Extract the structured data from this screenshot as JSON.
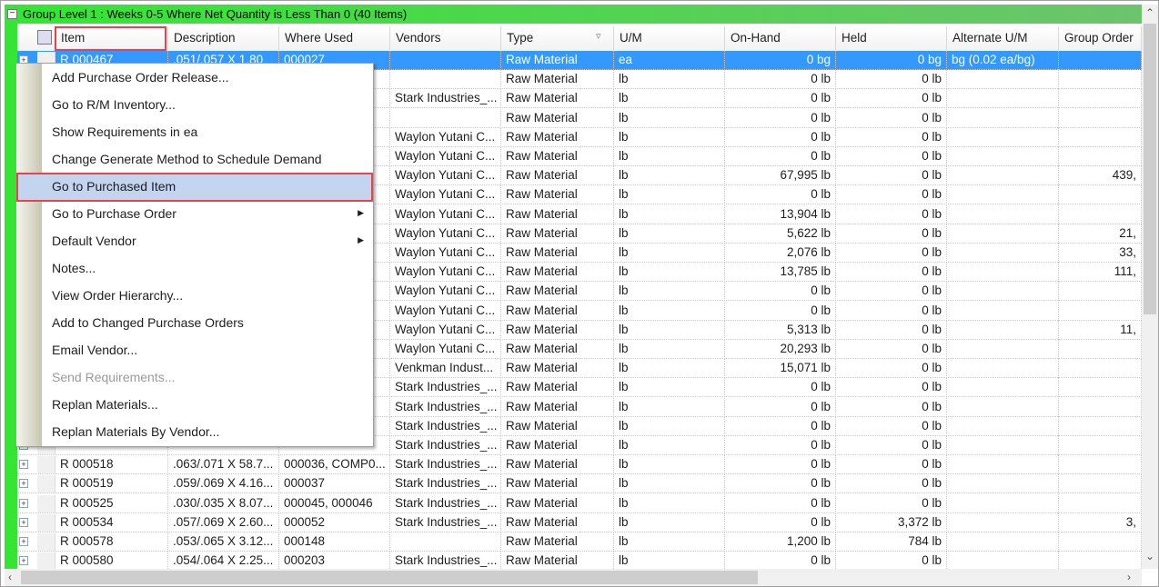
{
  "group": {
    "title": "Group Level 1 : Weeks 0-5 Where Net Quantity is Less Than 0 (40 Items)",
    "expand": "−"
  },
  "columns": [
    "Item",
    "Description",
    "Where Used",
    "Vendors",
    "Type",
    "U/M",
    "On-Hand",
    "Held",
    "Alternate U/M",
    "Group Order"
  ],
  "rows": [
    [
      "R 000467",
      ".051/.057 X 1.80",
      "000027",
      "",
      "Raw Material",
      "ea",
      "0 bg",
      "0 bg",
      "bg (0.02 ea/bg)",
      ""
    ],
    [
      "",
      "",
      "",
      "",
      "Raw Material",
      "lb",
      "0 lb",
      "0 lb",
      "",
      ""
    ],
    [
      "",
      "",
      "",
      "Stark Industries_...",
      "Raw Material",
      "lb",
      "0 lb",
      "0 lb",
      "",
      ""
    ],
    [
      "",
      "",
      "",
      "",
      "Raw Material",
      "lb",
      "0 lb",
      "0 lb",
      "",
      ""
    ],
    [
      "",
      "",
      "",
      "Waylon Yutani C...",
      "Raw Material",
      "lb",
      "0 lb",
      "0 lb",
      "",
      ""
    ],
    [
      "",
      "",
      "",
      "Waylon Yutani C...",
      "Raw Material",
      "lb",
      "0 lb",
      "0 lb",
      "",
      ""
    ],
    [
      "",
      "",
      "",
      "Waylon Yutani C...",
      "Raw Material",
      "lb",
      "67,995 lb",
      "0 lb",
      "",
      "439,"
    ],
    [
      "",
      "",
      "",
      "Waylon Yutani C...",
      "Raw Material",
      "lb",
      "0 lb",
      "0 lb",
      "",
      ""
    ],
    [
      "",
      "",
      "",
      "Waylon Yutani C...",
      "Raw Material",
      "lb",
      "13,904 lb",
      "0 lb",
      "",
      ""
    ],
    [
      "",
      "",
      "",
      "Waylon Yutani C...",
      "Raw Material",
      "lb",
      "5,622 lb",
      "0 lb",
      "",
      "21,"
    ],
    [
      "",
      "",
      "",
      "Waylon Yutani C...",
      "Raw Material",
      "lb",
      "2,076 lb",
      "0 lb",
      "",
      "33,"
    ],
    [
      "",
      "",
      "",
      "Waylon Yutani C...",
      "Raw Material",
      "lb",
      "13,785 lb",
      "0 lb",
      "",
      "111,"
    ],
    [
      "",
      "",
      "",
      "Waylon Yutani C...",
      "Raw Material",
      "lb",
      "0 lb",
      "0 lb",
      "",
      ""
    ],
    [
      "",
      "",
      "",
      "Waylon Yutani C...",
      "Raw Material",
      "lb",
      "0 lb",
      "0 lb",
      "",
      ""
    ],
    [
      "",
      "",
      "",
      "Waylon Yutani C...",
      "Raw Material",
      "lb",
      "5,313 lb",
      "0 lb",
      "",
      "11,"
    ],
    [
      "",
      "",
      "",
      "Waylon Yutani C...",
      "Raw Material",
      "lb",
      "20,293 lb",
      "0 lb",
      "",
      ""
    ],
    [
      "",
      "",
      "",
      "Venkman Indust...",
      "Raw Material",
      "lb",
      "15,071 lb",
      "0 lb",
      "",
      ""
    ],
    [
      "",
      "",
      "",
      "Stark Industries_...",
      "Raw Material",
      "lb",
      "0 lb",
      "0 lb",
      "",
      ""
    ],
    [
      "",
      "",
      "",
      "Stark Industries_...",
      "Raw Material",
      "lb",
      "0 lb",
      "0 lb",
      "",
      ""
    ],
    [
      "",
      "",
      "",
      "Stark Industries_...",
      "Raw Material",
      "lb",
      "0 lb",
      "0 lb",
      "",
      ""
    ],
    [
      "",
      "",
      "",
      "Stark Industries_...",
      "Raw Material",
      "lb",
      "0 lb",
      "0 lb",
      "",
      ""
    ],
    [
      "R 000518",
      ".063/.071 X 58.7...",
      "000036, COMP0...",
      "Stark Industries_...",
      "Raw Material",
      "lb",
      "0 lb",
      "0 lb",
      "",
      ""
    ],
    [
      "R 000519",
      ".059/.069 X 4.16...",
      "000037",
      "Stark Industries_...",
      "Raw Material",
      "lb",
      "0 lb",
      "0 lb",
      "",
      ""
    ],
    [
      "R 000525",
      ".030/.035 X 8.07...",
      "000045, 000046",
      "Stark Industries_...",
      "Raw Material",
      "lb",
      "0 lb",
      "0 lb",
      "",
      ""
    ],
    [
      "R 000534",
      ".057/.069 X 2.60...",
      "000052",
      "Stark Industries_...",
      "Raw Material",
      "lb",
      "0 lb",
      "3,372 lb",
      "",
      "3,"
    ],
    [
      "R 000578",
      ".053/.065 X 3.12...",
      "000148",
      "",
      "Raw Material",
      "lb",
      "1,200 lb",
      "784 lb",
      "",
      ""
    ],
    [
      "R 000580",
      ".054/.064 X 2.25...",
      "000203",
      "Stark Industries_...",
      "Raw Material",
      "lb",
      "0 lb",
      "0 lb",
      "",
      ""
    ]
  ],
  "context_menu": [
    {
      "label": "Add Purchase Order Release...",
      "enabled": true
    },
    {
      "label": "Go to R/M Inventory...",
      "enabled": true
    },
    {
      "label": "Show Requirements in ea",
      "enabled": true
    },
    {
      "label": "Change Generate Method to Schedule Demand",
      "enabled": true
    },
    {
      "label": "Go to Purchased Item",
      "enabled": true,
      "highlighted": true
    },
    {
      "label": "Go to Purchase Order",
      "enabled": true,
      "submenu": true
    },
    {
      "label": "Default Vendor",
      "enabled": true,
      "submenu": true
    },
    {
      "label": "Notes...",
      "enabled": true
    },
    {
      "label": "View Order Hierarchy...",
      "enabled": true
    },
    {
      "label": "Add to Changed Purchase Orders",
      "enabled": true
    },
    {
      "label": "Email Vendor...",
      "enabled": true
    },
    {
      "label": "Send Requirements...",
      "enabled": false
    },
    {
      "label": "Replan Materials...",
      "enabled": true
    },
    {
      "label": "Replan Materials By Vendor...",
      "enabled": true
    }
  ],
  "colors": {
    "group_band": "#33e633",
    "selection": "#3399ff",
    "highlight_border": "#e8434a",
    "menu_highlight": "#c3d4ee"
  }
}
